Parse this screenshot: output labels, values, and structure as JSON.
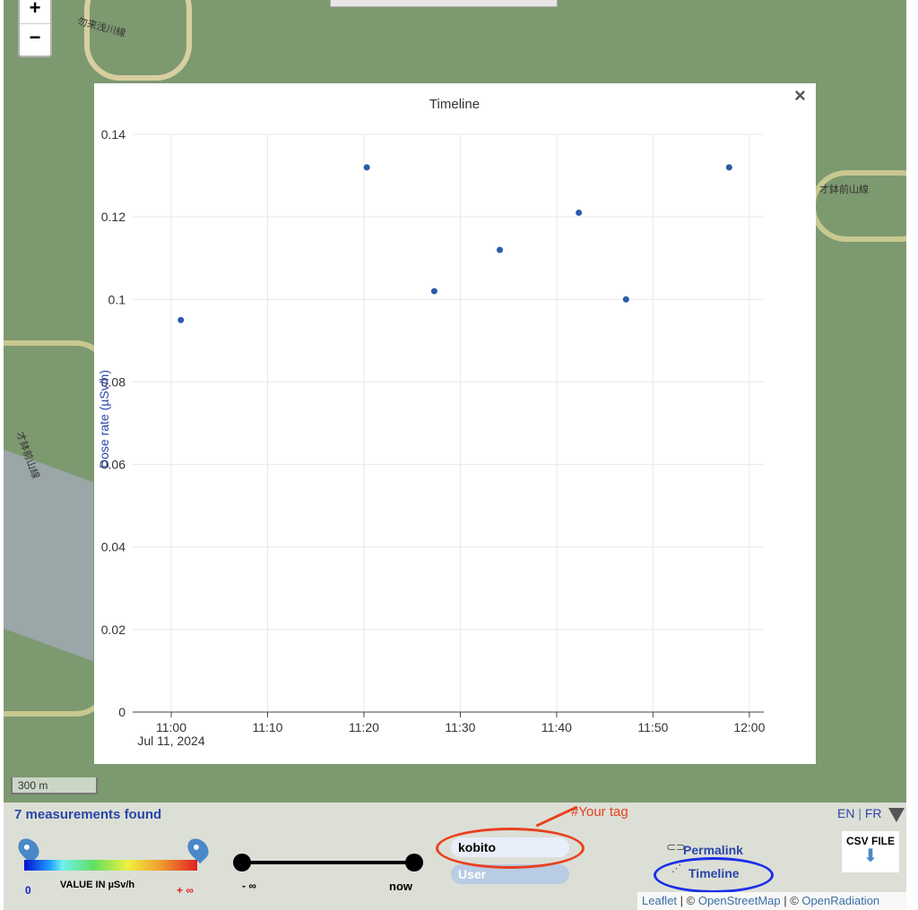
{
  "map": {
    "zoom_in": "+",
    "zoom_out": "−",
    "scale": "300 m",
    "labels": [
      "勿来浅川線",
      "才鉢前山線",
      "才鉢前山線"
    ]
  },
  "modal": {
    "close": "×"
  },
  "chart_data": {
    "type": "scatter",
    "title": "Timeline",
    "xlabel": "",
    "ylabel": "Dose rate (µSv/h)",
    "x_ticks": [
      "11:00",
      "11:10",
      "11:20",
      "11:30",
      "11:40",
      "11:50",
      "12:00"
    ],
    "x_sublabel": "Jul 11, 2024",
    "y_ticks": [
      "0",
      "0.02",
      "0.04",
      "0.06",
      "0.08",
      "0.1",
      "0.12",
      "0.14"
    ],
    "xlim": [
      "10:56",
      "12:01.5"
    ],
    "ylim": [
      0,
      0.14
    ],
    "grid": true,
    "color": "#2a5caa",
    "points": [
      {
        "x": "11:01",
        "y": 0.095
      },
      {
        "x": "11:20.3",
        "y": 0.132
      },
      {
        "x": "11:27.3",
        "y": 0.102
      },
      {
        "x": "11:34.1",
        "y": 0.112
      },
      {
        "x": "11:42.3",
        "y": 0.121
      },
      {
        "x": "11:47.2",
        "y": 0.1
      },
      {
        "x": "11:57.9",
        "y": 0.132
      }
    ]
  },
  "panel": {
    "count": "7 measurements found",
    "value_label": "VALUE IN µSv/h",
    "value_min": "0",
    "value_max": "+ ∞",
    "time_min": "- ∞",
    "time_max": "now",
    "tag_value": "kobito",
    "tag_annotation": "#Your tag",
    "user_placeholder": "User",
    "permalink": "Permalink",
    "timeline": "Timeline",
    "lang_en": "EN",
    "lang_sep": "|",
    "lang_fr": "FR",
    "csv": "CSV FILE",
    "attr_leaflet": "Leaflet",
    "attr_osm": "OpenStreetMap",
    "attr_or": "OpenRadiation",
    "attr_sep": " | © "
  }
}
